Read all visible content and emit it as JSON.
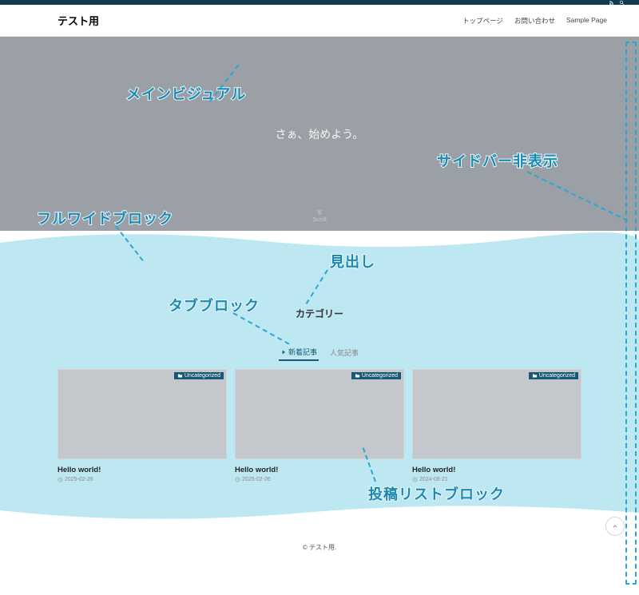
{
  "site": {
    "title": "テスト用"
  },
  "nav": {
    "items": [
      {
        "label": "トップページ"
      },
      {
        "label": "お問い合わせ"
      },
      {
        "label": "Sample Page"
      }
    ]
  },
  "hero": {
    "text": "さぁ、始めよう。",
    "scroll": "Scroll"
  },
  "section": {
    "heading": "カテゴリー"
  },
  "tabs": {
    "items": [
      {
        "label": "新着記事",
        "active": true
      },
      {
        "label": "人気記事",
        "active": false
      }
    ]
  },
  "posts": {
    "items": [
      {
        "badge": "Uncategorized",
        "title": "Hello world!",
        "date": "2025-02-26"
      },
      {
        "badge": "Uncategorized",
        "title": "Hello world!",
        "date": "2025-02-26"
      },
      {
        "badge": "Uncategorized",
        "title": "Hello world!",
        "date": "2024-08-21"
      }
    ]
  },
  "footer": {
    "copyright": "© テスト用."
  },
  "annotations": {
    "main_visual": "メインビジュアル",
    "fullwide": "フルワイドブロック",
    "tab_block": "タブブロック",
    "heading": "見出し",
    "sidebar_hidden": "サイドバー非表示",
    "post_list": "投稿リストブロック"
  }
}
